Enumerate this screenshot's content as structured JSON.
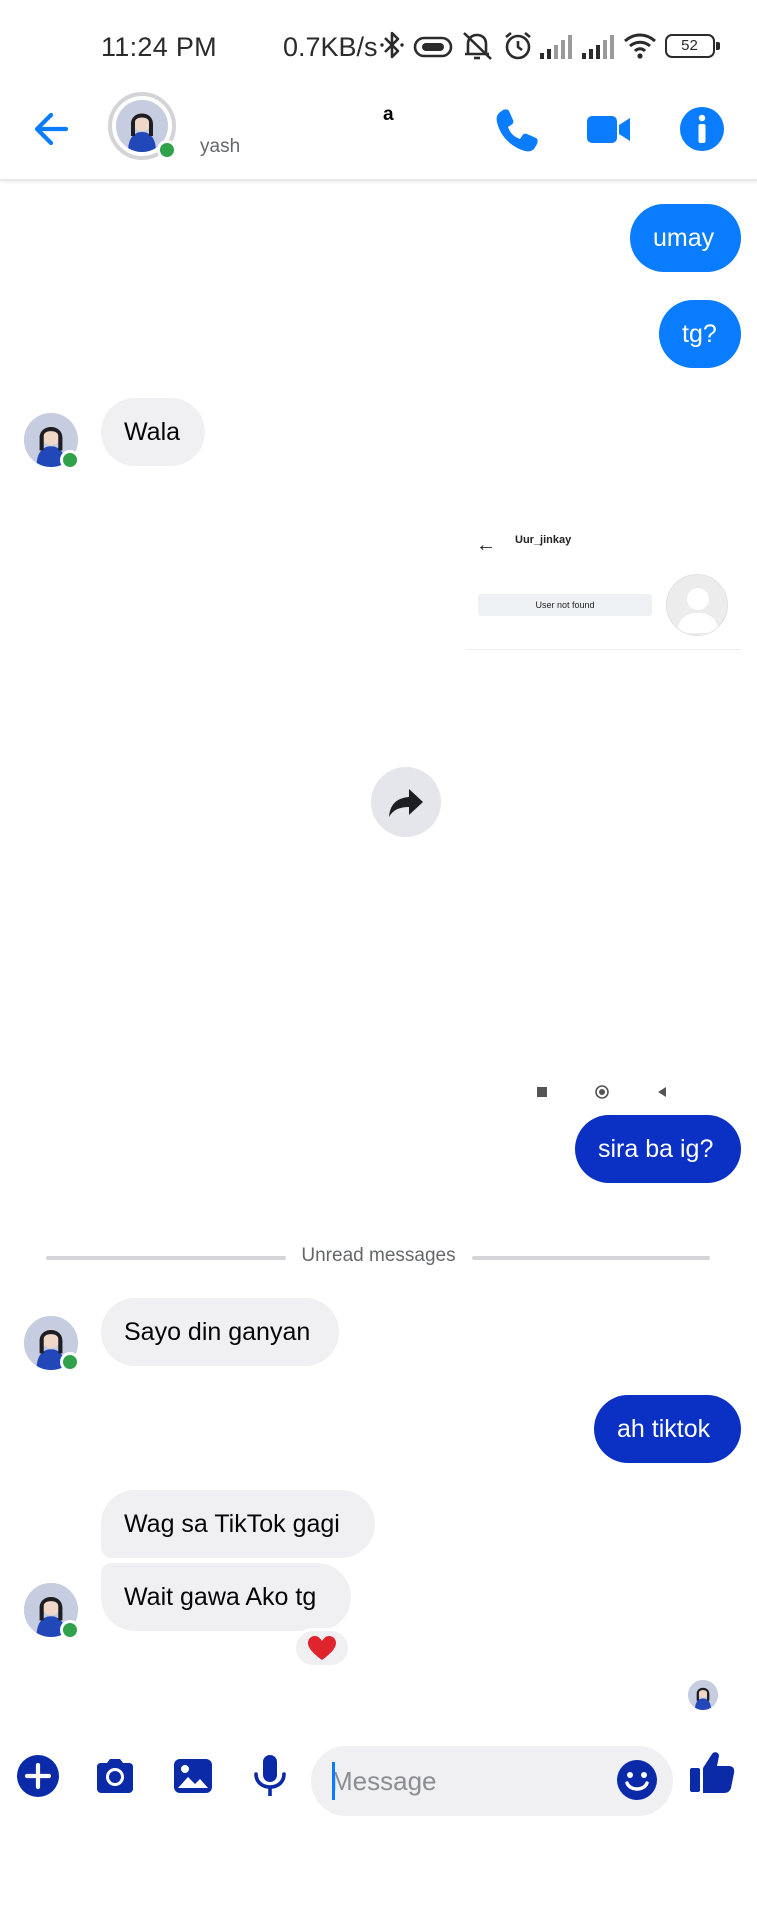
{
  "status_bar": {
    "time": "11:24 PM",
    "network_speed": "0.7KB/s",
    "battery": "52",
    "icons": [
      "bluetooth-icon",
      "vibrate-icon",
      "mute-icon",
      "alarm-icon",
      "signal-icon",
      "signal-icon",
      "wifi-icon",
      "battery-icon"
    ]
  },
  "header": {
    "name_fragment": "a",
    "subtitle": "yash",
    "icons": [
      "back-arrow-icon",
      "phone-icon",
      "video-camera-icon",
      "info-icon"
    ]
  },
  "colors": {
    "messenger_blue": "#0a7cff",
    "navy_bubble": "#0b30c4",
    "incoming_bubble": "#f0f0f2",
    "online_green": "#31a24c",
    "icon_blue": "#0a7cff",
    "composer_icon_navy": "#0b2aa8"
  },
  "messages": [
    {
      "side": "out",
      "text": "umay"
    },
    {
      "side": "out",
      "text": "tg?"
    },
    {
      "side": "in",
      "text": "Wala"
    },
    {
      "side": "out",
      "type": "image",
      "image": {
        "username": "Uur_jinkay",
        "notice": "User not found"
      }
    },
    {
      "side": "out",
      "text": "sira ba ig?"
    },
    {
      "side": "in",
      "text": "Sayo din ganyan"
    },
    {
      "side": "out",
      "text": "ah tiktok"
    },
    {
      "side": "in",
      "text": "Wag sa TikTok gagi"
    },
    {
      "side": "in",
      "text": "Wait gawa Ako tg",
      "reaction": "heart"
    }
  ],
  "divider": {
    "label": "Unread messages"
  },
  "composer": {
    "placeholder": "Message",
    "icons": [
      "plus-icon",
      "camera-icon",
      "gallery-icon",
      "microphone-icon",
      "emoji-icon",
      "thumbs-up-icon"
    ]
  }
}
